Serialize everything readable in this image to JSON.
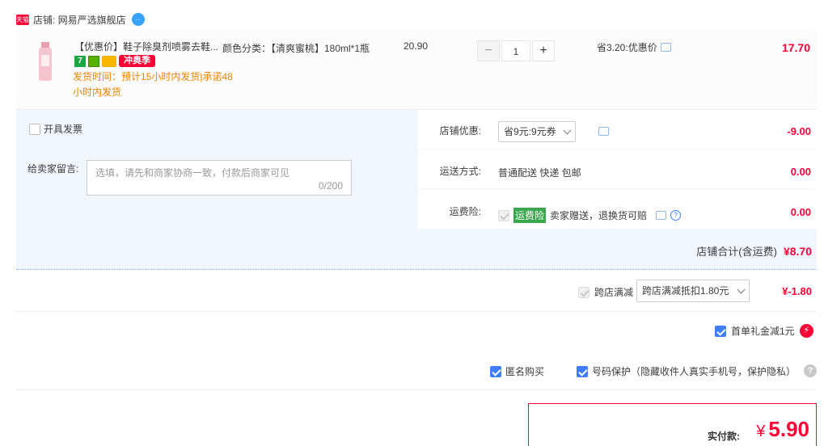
{
  "shop": {
    "logo_text": "天猫",
    "name": "店铺: 网易严选旗舰店",
    "chat_icon": "wangwang-chat-icon"
  },
  "item": {
    "title": "【优惠价】鞋子除臭剂喷雾去鞋...",
    "badge_7": "7",
    "tag_sale": "冲奥季",
    "ship_note": "发货时间：预计15小时内发货|承诺48小时内发货",
    "spec": "颜色分类：【清爽蜜桃】180ml*1瓶",
    "unit_price": "20.90",
    "qty_minus": "−",
    "qty_value": "1",
    "qty_plus": "+",
    "save_note": "省3.20:优惠价",
    "subtotal": "17.70"
  },
  "options": {
    "invoice_label": "开具发票",
    "message_label": "给卖家留言:",
    "message_placeholder": "选填，请先和商家协商一致，付款后商家可见",
    "message_count": "0/200",
    "shop_discount_label": "店铺优惠:",
    "shop_discount_value": "省9元:9元券",
    "shop_discount_amount": "-9.00",
    "shipping_label": "运送方式:",
    "shipping_value": "普通配送 快递 包邮",
    "shipping_amount": "0.00",
    "insurance_label": "运费险:",
    "insurance_tag": "运费险",
    "insurance_value": "卖家赠送，退换货可赔",
    "insurance_amount": "0.00",
    "shop_total_label": "店铺合计(含运费)",
    "shop_total_value": "¥8.70"
  },
  "cross_store": {
    "label": "跨店满减",
    "select_value": "跨店满减抵扣1.80元",
    "amount": "¥-1.80"
  },
  "gift": {
    "label": "首单礼金减1元",
    "icon": "⚡"
  },
  "privacy": {
    "anonymous_label": "匿名购买",
    "phone_label": "号码保护（隐藏收件人真实手机号，保护隐私）",
    "help": "?"
  },
  "payment": {
    "label": "实付款:",
    "currency": "¥",
    "amount": "5.90"
  },
  "colors": {
    "accent_red": "#ff0036",
    "check_blue": "#3f7fff",
    "ship_orange": "#f08300"
  }
}
